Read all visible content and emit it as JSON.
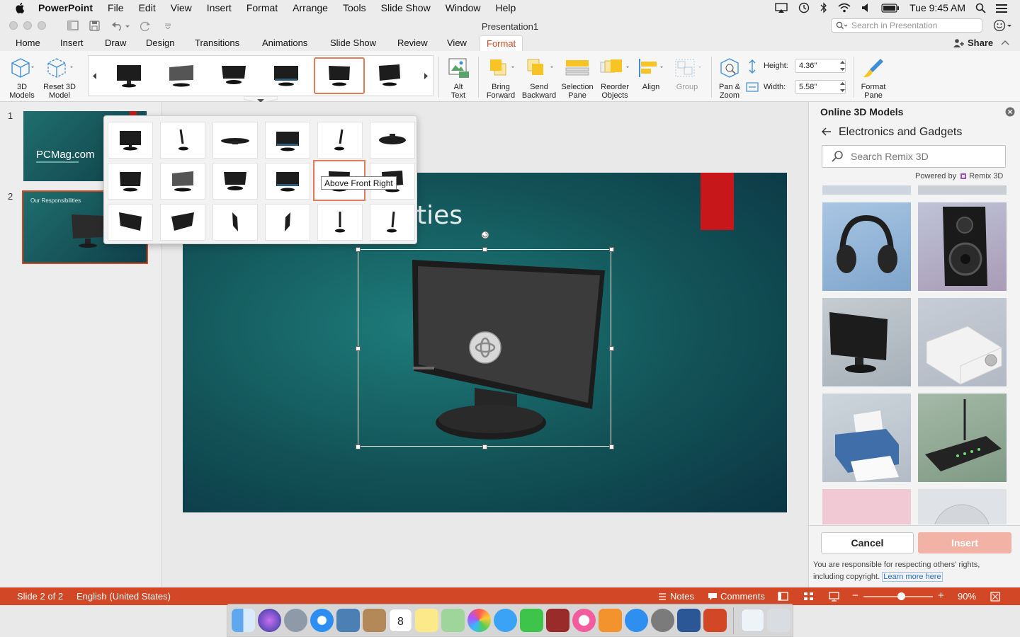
{
  "menubar": {
    "app": "PowerPoint",
    "items": [
      "File",
      "Edit",
      "View",
      "Insert",
      "Format",
      "Arrange",
      "Tools",
      "Slide Show",
      "Window",
      "Help"
    ],
    "clock": "Tue 9:45 AM"
  },
  "window": {
    "title": "Presentation1",
    "search_placeholder": "Search in Presentation"
  },
  "tabs": {
    "items": [
      "Home",
      "Insert",
      "Draw",
      "Design",
      "Transitions",
      "Animations",
      "Slide Show",
      "Review",
      "View",
      "Format"
    ],
    "active": "Format",
    "share_label": "Share"
  },
  "ribbon": {
    "models_3d": [
      "3D",
      "Models"
    ],
    "reset_3d": [
      "Reset 3D",
      "Model"
    ],
    "alt_text": [
      "Alt",
      "Text"
    ],
    "bring_forward": [
      "Bring",
      "Forward"
    ],
    "send_backward": [
      "Send",
      "Backward"
    ],
    "selection_pane": [
      "Selection",
      "Pane"
    ],
    "reorder_objects": [
      "Reorder",
      "Objects"
    ],
    "align": "Align",
    "group": "Group",
    "pan_zoom": [
      "Pan &",
      "Zoom"
    ],
    "height_label": "Height:",
    "height_value": "4.36\"",
    "width_label": "Width:",
    "width_value": "5.58\"",
    "format_pane": [
      "Format",
      "Pane"
    ]
  },
  "slides": [
    {
      "number": "1",
      "title": "PCMag.com"
    },
    {
      "number": "2",
      "title": "Our Responsibilities"
    }
  ],
  "slide_title_fragment": "ties",
  "tooltip": "Above Front Right",
  "right_panel": {
    "title": "Online 3D Models",
    "category": "Electronics and Gadgets",
    "search_placeholder": "Search Remix 3D",
    "powered_by": "Powered by",
    "remix": "Remix 3D",
    "cancel_label": "Cancel",
    "insert_label": "Insert",
    "disclaimer": "You are responsible for respecting others' rights, including copyright.",
    "learn_more": "Learn more here"
  },
  "statusbar": {
    "slide_info": "Slide 2 of 2",
    "language": "English (United States)",
    "notes": "Notes",
    "comments": "Comments",
    "zoom": "90%",
    "zoom_level": 0.55
  },
  "colors": {
    "accent": "#d24726",
    "tab_active": "#d04a23",
    "slide_bg": "#125257",
    "red_bar": "#c8171a",
    "insert_disabled": "#f2b3a6"
  }
}
